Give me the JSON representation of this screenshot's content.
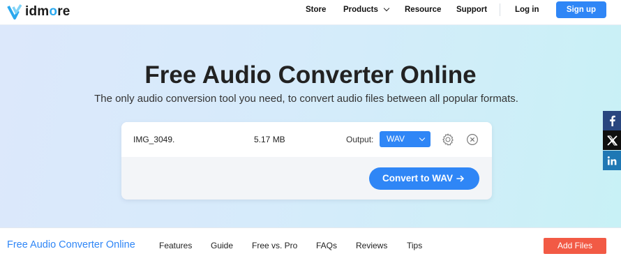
{
  "nav": {
    "logo_text_start": "idm",
    "logo_text_o": "o",
    "logo_text_end": "re",
    "links": [
      "Store",
      "Products",
      "Resource",
      "Support"
    ],
    "login": "Log in",
    "signup": "Sign up"
  },
  "hero": {
    "title": "Free Audio Converter Online",
    "subtitle": "The only audio conversion tool you need, to convert audio files between all popular formats."
  },
  "file_card": {
    "file_name": "IMG_3049.",
    "file_size": "5.17 MB",
    "output_label": "Output:",
    "output_format": "WAV",
    "settings_icon": "gear-icon",
    "remove_icon": "close-circle-icon",
    "convert_label": "Convert to WAV",
    "accent_color": "#2f86f6"
  },
  "social": [
    "facebook-icon",
    "x-icon",
    "linkedin-icon"
  ],
  "bottom_bar": {
    "title": "Free Audio Converter Online",
    "links": [
      "Features",
      "Guide",
      "Free vs. Pro",
      "FAQs",
      "Reviews",
      "Tips"
    ],
    "add_files": "Add Files",
    "add_files_color": "#f25a45"
  }
}
